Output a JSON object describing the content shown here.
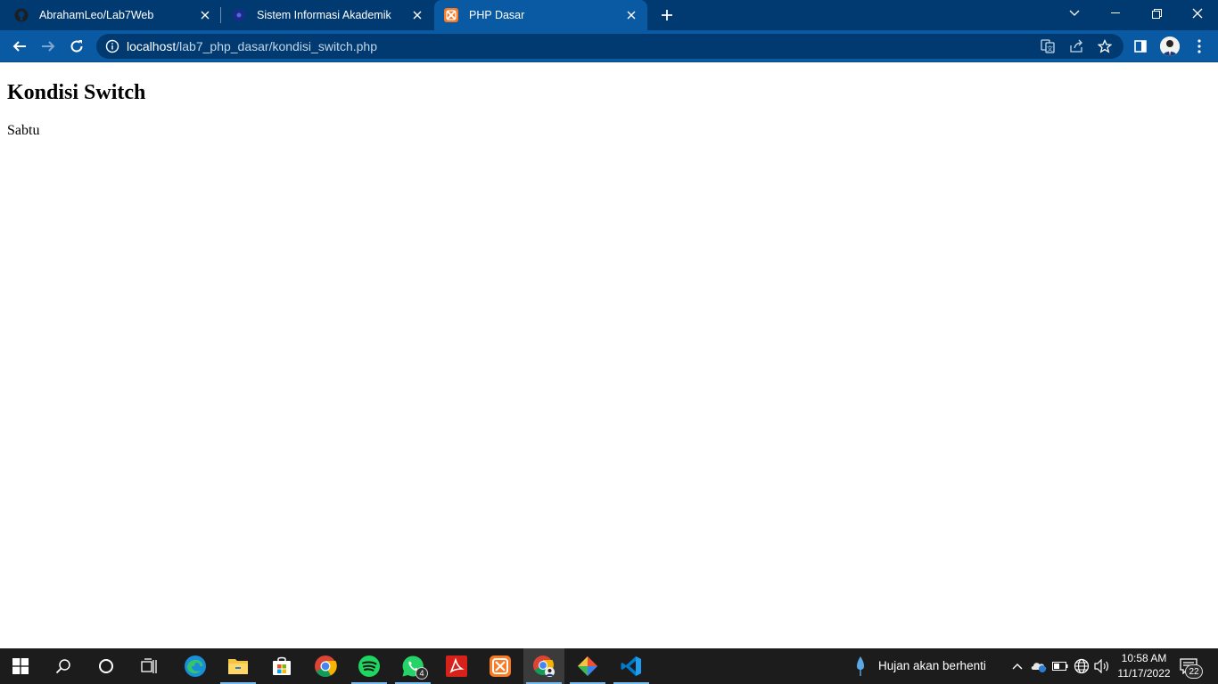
{
  "browser": {
    "tabs": [
      {
        "title": "AbrahamLeo/Lab7Web",
        "icon": "github-icon"
      },
      {
        "title": "Sistem Informasi Akademik",
        "icon": "academic-site-icon"
      },
      {
        "title": "PHP Dasar",
        "icon": "xampp-icon",
        "active": true
      }
    ],
    "url_host": "localhost",
    "url_path": "/lab7_php_dasar/kondisi_switch.php",
    "theme_colors": {
      "tabstrip": "#003a70",
      "toolbar": "#0a5aa3"
    }
  },
  "page": {
    "heading": "Kondisi Switch",
    "output": "Sabtu"
  },
  "taskbar": {
    "pinned_apps": [
      "start",
      "search",
      "cortana",
      "task-view",
      "edge",
      "file-explorer",
      "microsoft-store",
      "chrome",
      "spotify",
      "whatsapp",
      "acrobat",
      "xampp",
      "chrome-profile",
      "git",
      "vscode"
    ],
    "whatsapp_badge": "4",
    "weather": "Hujan akan berhenti",
    "time": "10:58 AM",
    "date": "11/17/2022",
    "notification_count": "22"
  }
}
